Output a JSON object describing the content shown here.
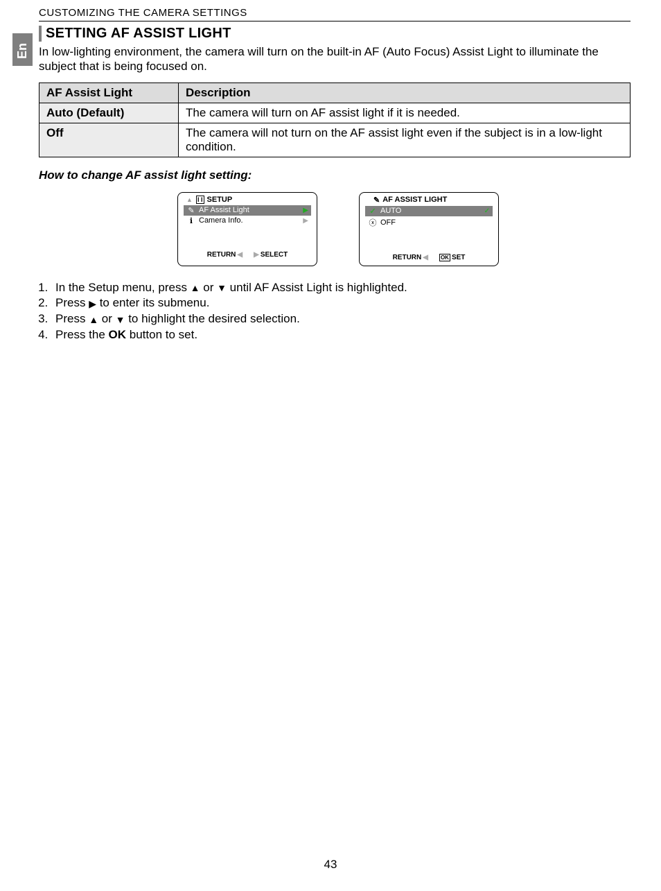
{
  "lang_tab": "En",
  "header": "CUSTOMIZING THE CAMERA SETTINGS",
  "section_title": "SETTING AF ASSIST LIGHT",
  "section_body": "In low-lighting environment, the camera will turn on the built-in AF (Auto Focus) Assist Light to illuminate the subject that is being focused on.",
  "table": {
    "col1": "AF Assist Light",
    "col2": "Description",
    "rows": [
      {
        "opt": "Auto (Default)",
        "desc": "The camera will turn on AF assist light if it is needed."
      },
      {
        "opt": "Off",
        "desc": "The camera will not turn on the AF assist light even if the subject is in a low-light condition."
      }
    ]
  },
  "howto": "How to change AF assist light setting:",
  "screen1": {
    "title": "SETUP",
    "rows": [
      {
        "icon": "af-icon",
        "label": "AF Assist Light",
        "selected": true,
        "arrow": "▶",
        "arrow_color": "green"
      },
      {
        "icon": "info-icon",
        "label": "Camera Info.",
        "selected": false,
        "arrow": "▶",
        "arrow_color": "gray"
      }
    ],
    "footer": {
      "left": "RETURN",
      "right": "SELECT"
    }
  },
  "screen2": {
    "title": "AF ASSIST LIGHT",
    "rows": [
      {
        "icon": "check-icon",
        "label": "AUTO",
        "selected": true,
        "arrow": "✓",
        "arrow_color": "green"
      },
      {
        "icon": "x-icon",
        "label": "OFF",
        "selected": false,
        "arrow": "",
        "arrow_color": ""
      }
    ],
    "footer": {
      "left": "RETURN",
      "right": "SET"
    }
  },
  "steps": {
    "s1a": "In the Setup menu, press ",
    "s1b": " or ",
    "s1c": " until AF Assist Light is highlighted.",
    "s2a": "Press ",
    "s2b": " to enter its submenu.",
    "s3a": "Press ",
    "s3b": " or ",
    "s3c": " to highlight the desired selection.",
    "s4a": "Press the ",
    "s4b": "OK",
    "s4c": " button to set."
  },
  "page_number": "43"
}
